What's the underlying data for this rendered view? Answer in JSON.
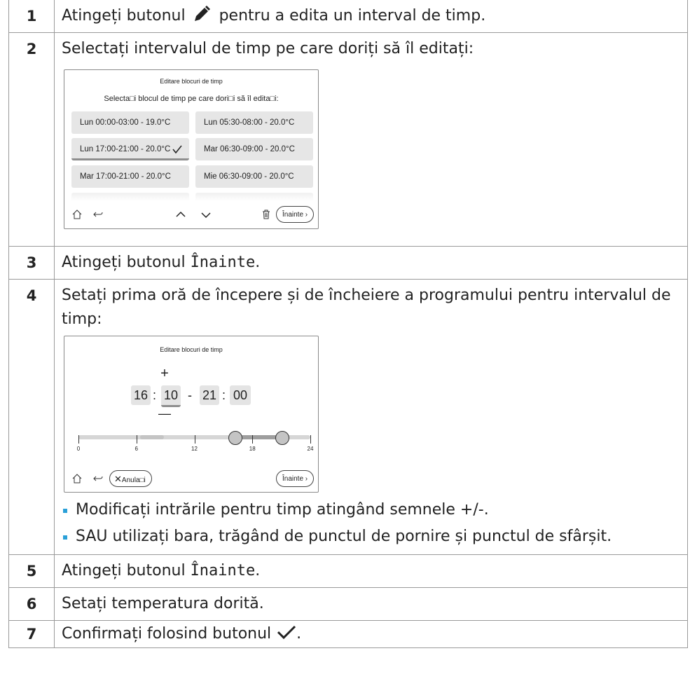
{
  "steps": [
    {
      "num": "1",
      "pre": "Atingeți butonul",
      "post": "pentru a edita un interval de timp."
    },
    {
      "num": "2",
      "text": "Selectați intervalul de timp pe care doriți să îl editați:"
    },
    {
      "num": "3",
      "pre": "Atingeți butonul ",
      "button": "Înainte",
      "post": "."
    },
    {
      "num": "4",
      "text": "Setați prima oră de începere și de încheiere a programului pentru intervalul de timp:"
    },
    {
      "num": "5",
      "pre": "Atingeți butonul ",
      "button": "Înainte",
      "post": "."
    },
    {
      "num": "6",
      "text": "Setați temperatura dorită."
    },
    {
      "num": "7",
      "pre": "Confirmați folosind butonul",
      "post": "."
    }
  ],
  "screen1": {
    "title": "Editare blocuri de timp",
    "subtitle": "Selecta□i blocul de timp pe care dori□i să îl edita□i:",
    "blocks": [
      "Lun 00:00-03:00 - 19.0°C",
      "Lun 05:30-08:00 - 20.0°C",
      "Lun 17:00-21:00 - 20.0°C",
      "Mar 06:30-09:00 - 20.0°C",
      "Mar 17:00-21:00 - 20.0°C",
      "Mie 06:30-09:00 - 20.0°C"
    ],
    "selected_index": 2,
    "next_label": "Înainte"
  },
  "screen2": {
    "title": "Editare blocuri de timp",
    "plus": "+",
    "minus": "—",
    "start_hour": "16",
    "start_min": "10",
    "dash": "-",
    "end_hour": "21",
    "end_min": "00",
    "colon": ":",
    "scale_ticks": [
      "0",
      "6",
      "12",
      "18",
      "24"
    ],
    "range_start_h": 16.17,
    "range_end_h": 21.0,
    "cancel_label": "Anula□i",
    "next_label": "Înainte"
  },
  "step4_bullets": [
    "Modificați intrările pentru timp atingând semnele +/-.",
    "SAU utilizați bara, trăgând de punctul de pornire și punctul de sfârșit."
  ],
  "colors": {
    "bullet": "#2aa0d8",
    "border": "#9a9a9a",
    "button_bg": "#e6e6e6"
  }
}
